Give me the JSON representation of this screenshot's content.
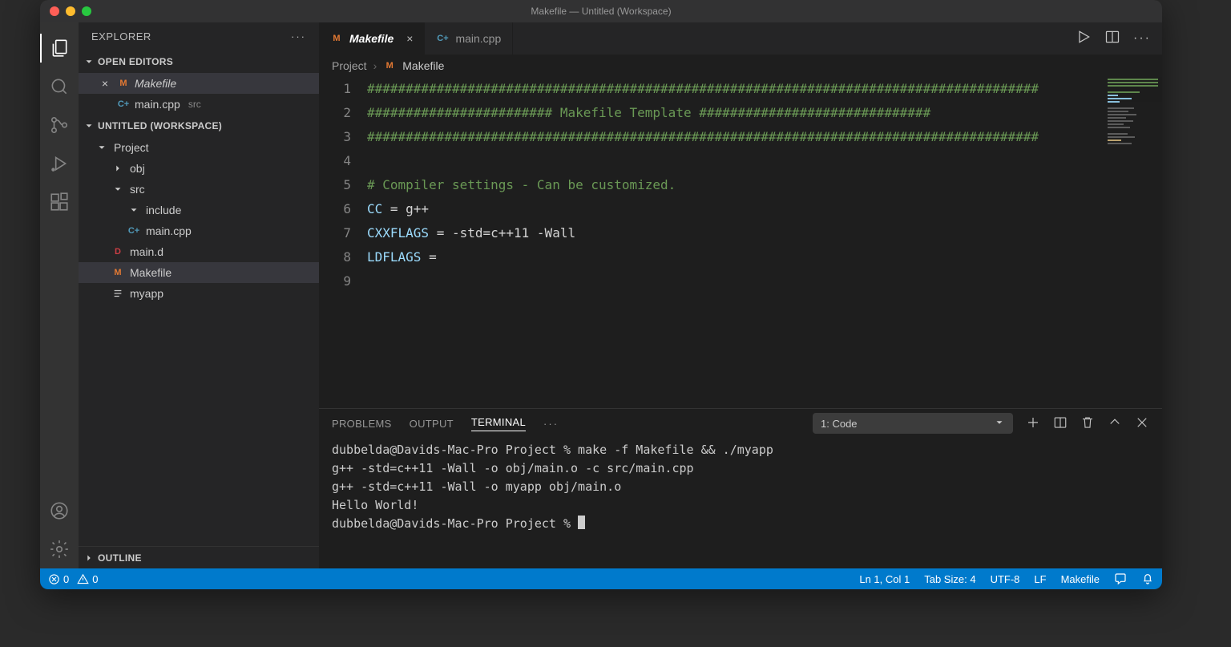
{
  "window": {
    "title": "Makefile — Untitled (Workspace)"
  },
  "sidebar": {
    "title": "EXPLORER",
    "openEditors": {
      "label": "OPEN EDITORS",
      "items": [
        {
          "name": "Makefile",
          "icon": "M",
          "italic": true,
          "close": true
        },
        {
          "name": "main.cpp",
          "icon": "C+",
          "hint": "src"
        }
      ]
    },
    "workspace": {
      "label": "UNTITLED (WORKSPACE)",
      "tree": [
        {
          "name": "Project",
          "type": "folder",
          "open": true,
          "indent": 20
        },
        {
          "name": "obj",
          "type": "folder",
          "open": false,
          "indent": 40
        },
        {
          "name": "src",
          "type": "folder",
          "open": true,
          "indent": 40
        },
        {
          "name": "include",
          "type": "folder",
          "open": true,
          "indent": 60
        },
        {
          "name": "main.cpp",
          "type": "cpp",
          "indent": 60
        },
        {
          "name": "main.d",
          "type": "d",
          "indent": 40
        },
        {
          "name": "Makefile",
          "type": "m",
          "active": true,
          "indent": 40
        },
        {
          "name": "myapp",
          "type": "file",
          "indent": 40
        }
      ]
    },
    "outline": {
      "label": "OUTLINE"
    }
  },
  "tabs": [
    {
      "label": "Makefile",
      "icon": "M",
      "active": true,
      "italic": true
    },
    {
      "label": "main.cpp",
      "icon": "C+",
      "active": false
    }
  ],
  "breadcrumb": {
    "folder": "Project",
    "file": "Makefile"
  },
  "editor": {
    "lines": [
      {
        "n": "1",
        "cls": "c-comment",
        "t": "#######################################################################################"
      },
      {
        "n": "2",
        "cls": "c-comment",
        "t": "######################## Makefile Template ##############################"
      },
      {
        "n": "3",
        "cls": "c-comment",
        "t": "#######################################################################################"
      },
      {
        "n": "4",
        "cls": "",
        "t": ""
      },
      {
        "n": "5",
        "cls": "c-comment",
        "t": "# Compiler settings - Can be customized."
      },
      {
        "n": "6",
        "var": "CC",
        "rest": " = g++"
      },
      {
        "n": "7",
        "var": "CXXFLAGS",
        "rest": " = -std=c++11 -Wall"
      },
      {
        "n": "8",
        "var": "LDFLAGS",
        "rest": " ="
      },
      {
        "n": "9",
        "cls": "",
        "t": ""
      }
    ]
  },
  "panel": {
    "tabs": [
      "PROBLEMS",
      "OUTPUT",
      "TERMINAL"
    ],
    "activeTab": "TERMINAL",
    "termSelect": "1: Code",
    "terminal": [
      "dubbelda@Davids-Mac-Pro Project % make -f Makefile && ./myapp",
      "g++ -std=c++11 -Wall -o obj/main.o -c src/main.cpp",
      "g++ -std=c++11 -Wall -o myapp obj/main.o",
      "Hello World!",
      "dubbelda@Davids-Mac-Pro Project % "
    ]
  },
  "statusbar": {
    "errors": "0",
    "warnings": "0",
    "lnCol": "Ln 1, Col 1",
    "tabSize": "Tab Size: 4",
    "encoding": "UTF-8",
    "eol": "LF",
    "lang": "Makefile"
  }
}
